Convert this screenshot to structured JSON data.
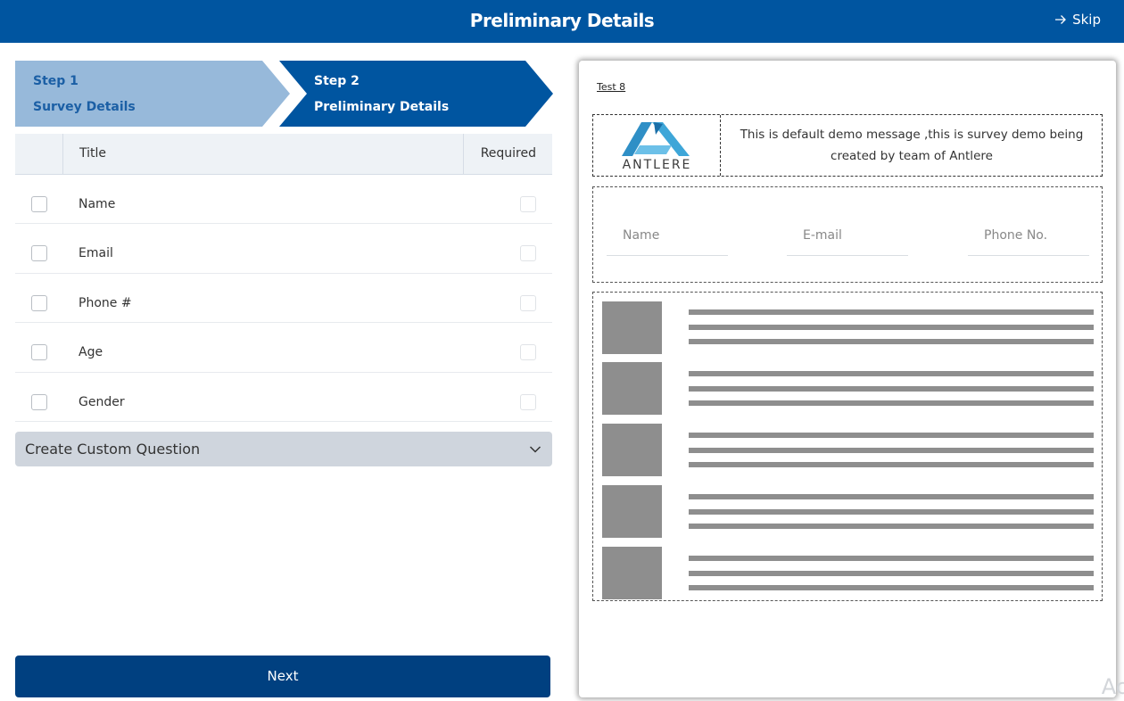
{
  "header": {
    "title": "Preliminary Details",
    "skip_label": "Skip"
  },
  "stepper": {
    "steps": [
      {
        "number": "Step 1",
        "name": "Survey Details"
      },
      {
        "number": "Step 2",
        "name": "Preliminary Details"
      }
    ],
    "colors": {
      "inactive": "#97b9da",
      "active": "#0055a0"
    }
  },
  "fields_table": {
    "columns": {
      "title": "Title",
      "required": "Required"
    },
    "rows": [
      {
        "label": "Name"
      },
      {
        "label": "Email"
      },
      {
        "label": "Phone #"
      },
      {
        "label": "Age"
      },
      {
        "label": "Gender"
      }
    ]
  },
  "custom_question": {
    "label": "Create Custom Question"
  },
  "next_label": "Next",
  "preview": {
    "link": "Test 8",
    "logo_text": "ANTLERE",
    "message": "This is default demo message ,this is survey demo being created by team of Antlere",
    "fields": [
      "Name",
      "E-mail",
      "Phone No."
    ],
    "list_items": 5
  },
  "corner_text": "Ac",
  "colors": {
    "brand": "#0055a0",
    "button": "#004080",
    "placeholder_block": "#8e8e8e",
    "logo_accent": "#3ea6d8"
  }
}
